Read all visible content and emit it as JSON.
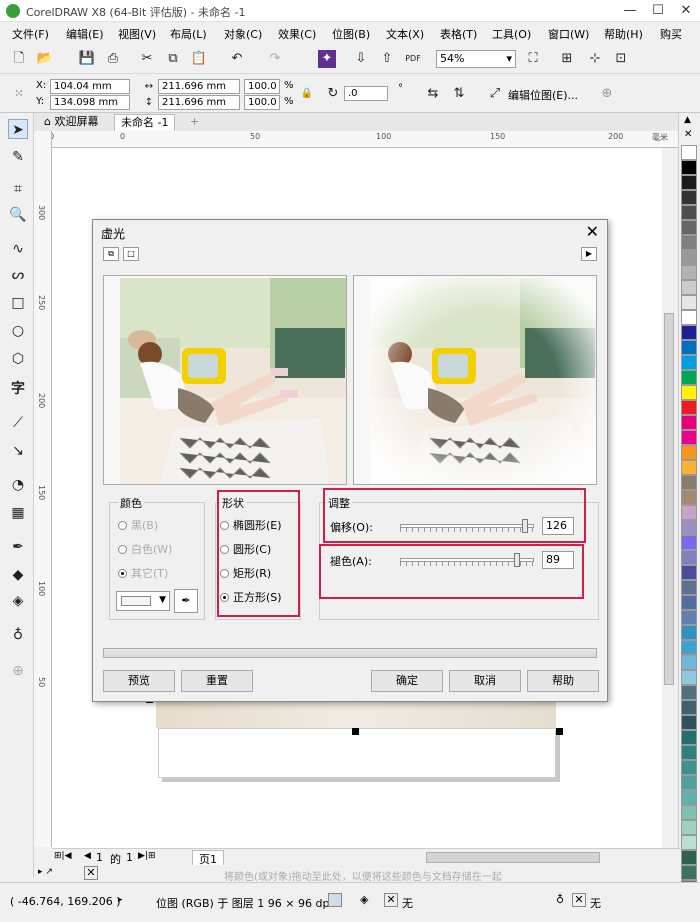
{
  "window": {
    "title": "CorelDRAW X8 (64-Bit 评估版) - 未命名 -1",
    "min": "—",
    "max": "☐",
    "close": "✕"
  },
  "menu": [
    "文件(F)",
    "编辑(E)",
    "视图(V)",
    "布局(L)",
    "对象(C)",
    "效果(C)",
    "位图(B)",
    "文本(X)",
    "表格(T)",
    "工具(O)",
    "窗口(W)",
    "帮助(H)",
    "购买"
  ],
  "toolbar": {
    "zoom": "54%",
    "edit_bitmap": "编辑位图(E)..."
  },
  "props": {
    "x_label": "X:",
    "x": "104.04 mm",
    "y_label": "Y:",
    "y": "134.098 mm",
    "w": "211.696 mm",
    "h": "211.696 mm",
    "sx": "100.0",
    "sy": "100.0",
    "pct": "%",
    "angle": ".0",
    "deg": "°"
  },
  "tabs": {
    "welcome": "欢迎屏幕",
    "doc": "未命名 -1",
    "add": "+"
  },
  "ruler": {
    "h": [
      "50",
      "0",
      "50",
      "100",
      "150",
      "200",
      "250"
    ],
    "h_unit": "毫米",
    "v": [
      "300",
      "250",
      "200",
      "150",
      "100",
      "50"
    ]
  },
  "dialog": {
    "title": "虚光",
    "close": "✕",
    "color_group": "颜色",
    "color_black": "黑(B)",
    "color_white": "白色(W)",
    "color_other": "其它(T)",
    "shape_group": "形状",
    "shape_ellipse": "椭圆形(E)",
    "shape_circle": "圆形(C)",
    "shape_rect": "矩形(R)",
    "shape_square": "正方形(S)",
    "adjust_group": "调整",
    "offset_label": "偏移(O):",
    "offset_value": "126",
    "offset_fraction": 0.95,
    "fade_label": "褪色(A):",
    "fade_value": "89",
    "fade_fraction": 0.89,
    "btn_preview": "预览",
    "btn_reset": "重置",
    "btn_ok": "确定",
    "btn_cancel": "取消",
    "btn_help": "帮助"
  },
  "pagenav": {
    "current": "1",
    "of": "的",
    "total": "1",
    "page_tab": "页1"
  },
  "dropbar": {
    "hint": "将颜色(或对象)拖动至此处，以便将这些颜色与文档存储在一起"
  },
  "status": {
    "coords": "( -46.764, 169.206 )",
    "info": "位图 (RGB) 于 图层 1 96 × 96 dpi",
    "fill": "无",
    "outline": "无"
  },
  "palette": [
    "#ffffff",
    "#000000",
    "#1a1a1a",
    "#333333",
    "#4d4d4d",
    "#666666",
    "#808080",
    "#999999",
    "#b3b3b3",
    "#cccccc",
    "#e6e6e6",
    "#ffffff",
    "#1e1e96",
    "#0070c0",
    "#00a0e0",
    "#00a651",
    "#fff200",
    "#ed1c24",
    "#e6007e",
    "#ec008c",
    "#f7941d",
    "#f9b233",
    "#8b7d6b",
    "#a68a6d",
    "#c8a2c8",
    "#9b8ec4",
    "#7b68ee",
    "#8080c0",
    "#4b4b9b",
    "#607090",
    "#5070a0",
    "#6080b0",
    "#3090c0",
    "#40a0d0",
    "#70b8d8",
    "#90c8e0",
    "#507080",
    "#406070",
    "#305060",
    "#207070",
    "#308080",
    "#409090",
    "#50a0a0",
    "#60b0b0",
    "#80c0b0",
    "#a0d0c0",
    "#b8e0d0",
    "#306050",
    "#407060",
    "#508070"
  ]
}
